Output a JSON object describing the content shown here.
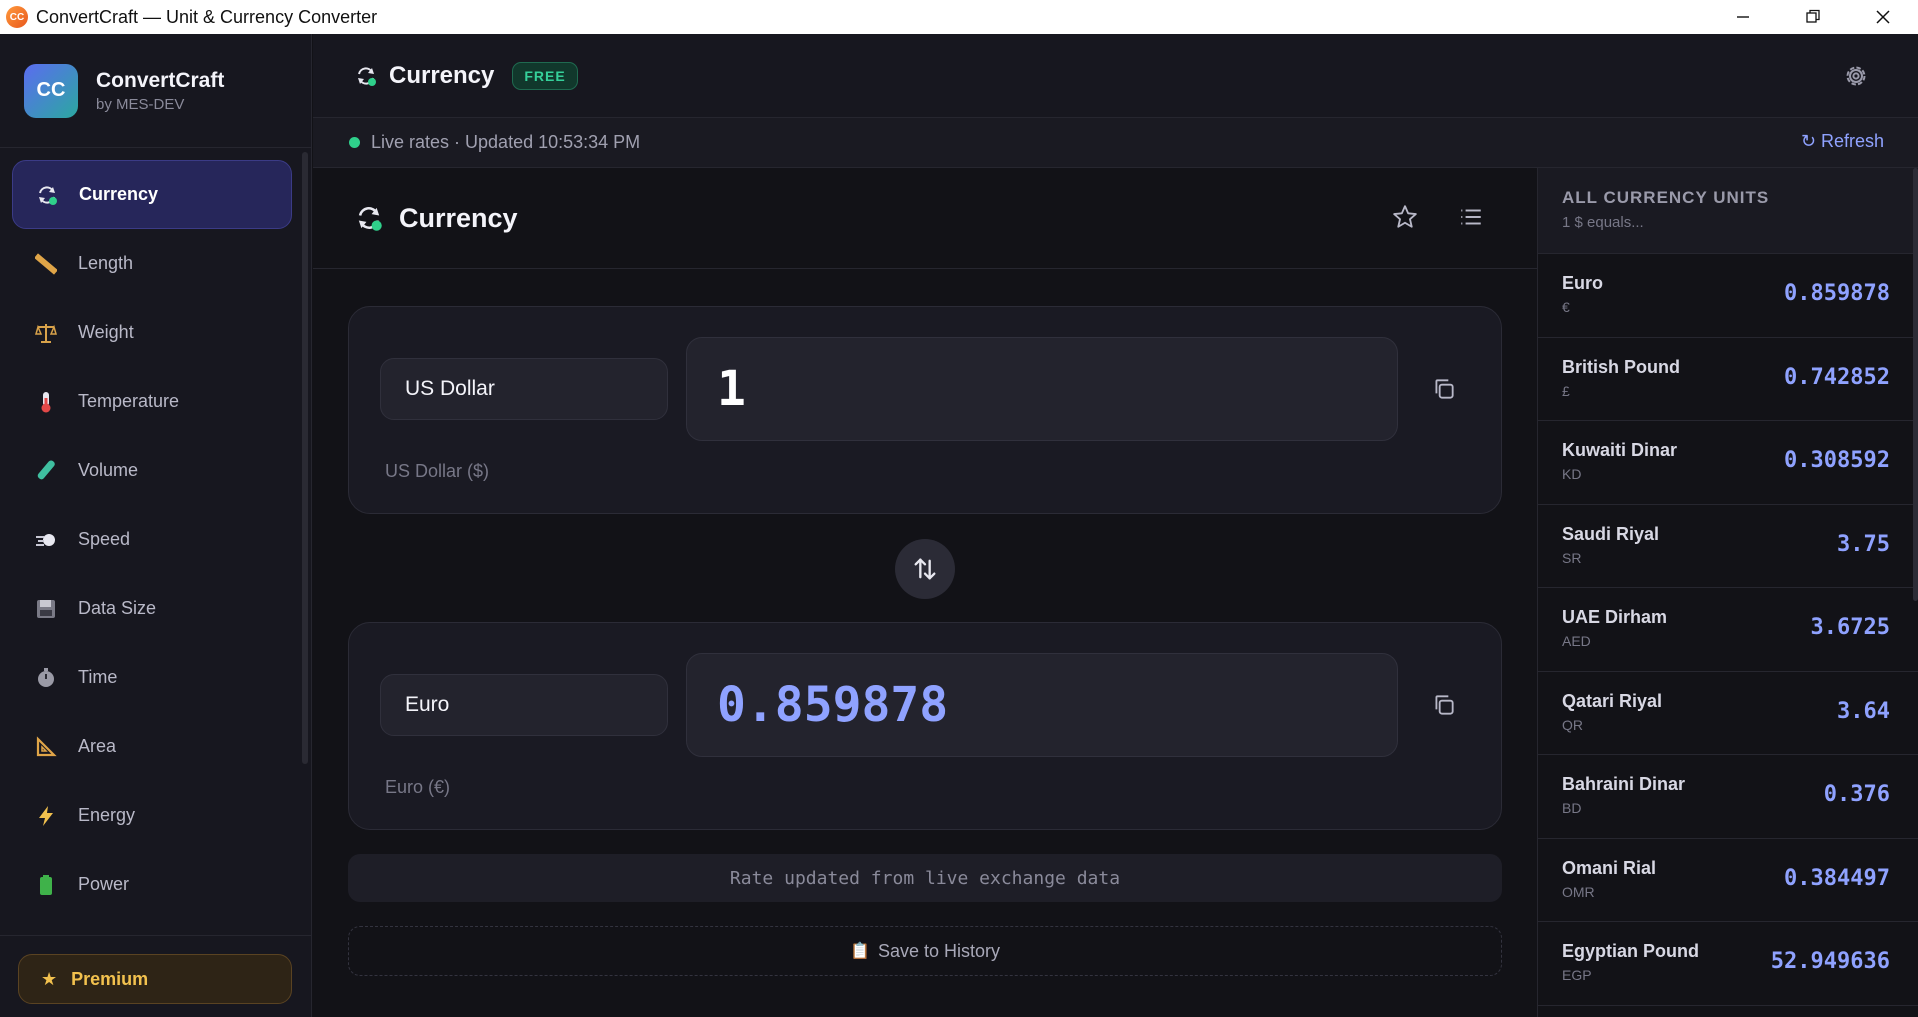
{
  "window": {
    "title": "ConvertCraft — Unit & Currency Converter",
    "icon_text": "CC"
  },
  "brand": {
    "logo": "CC",
    "name": "ConvertCraft",
    "byline": "by MES-DEV"
  },
  "sidebar": {
    "items": [
      {
        "label": "Currency",
        "icon": "currency-exchange-icon",
        "active": true
      },
      {
        "label": "Length",
        "icon": "ruler-icon"
      },
      {
        "label": "Weight",
        "icon": "scale-icon"
      },
      {
        "label": "Temperature",
        "icon": "thermometer-icon"
      },
      {
        "label": "Volume",
        "icon": "test-tube-icon"
      },
      {
        "label": "Speed",
        "icon": "dash-icon"
      },
      {
        "label": "Data Size",
        "icon": "floppy-disk-icon"
      },
      {
        "label": "Time",
        "icon": "stopwatch-icon"
      },
      {
        "label": "Area",
        "icon": "triangle-ruler-icon"
      },
      {
        "label": "Energy",
        "icon": "lightning-icon"
      },
      {
        "label": "Power",
        "icon": "battery-icon"
      }
    ],
    "premium_label": "Premium"
  },
  "header": {
    "title": "Currency",
    "badge": "FREE"
  },
  "status": {
    "text": "Live rates · Updated 10:53:34 PM",
    "refresh_label": "↻ Refresh",
    "dot_color": "#2fd08b"
  },
  "converter": {
    "title": "Currency",
    "from": {
      "unit": "US Dollar",
      "value": "1",
      "sub": "US Dollar ($)"
    },
    "to": {
      "unit": "Euro",
      "value": "0.859878",
      "sub": "Euro (€)"
    },
    "rate_note": "Rate updated from live exchange data",
    "save_label": "Save to History"
  },
  "units_panel": {
    "title": "ALL CURRENCY UNITS",
    "subtitle": "1 $ equals...",
    "rows": [
      {
        "name": "Euro",
        "symbol": "€",
        "value": "0.859878"
      },
      {
        "name": "British Pound",
        "symbol": "£",
        "value": "0.742852"
      },
      {
        "name": "Kuwaiti Dinar",
        "symbol": "KD",
        "value": "0.308592"
      },
      {
        "name": "Saudi Riyal",
        "symbol": "SR",
        "value": "3.75"
      },
      {
        "name": "UAE Dirham",
        "symbol": "AED",
        "value": "3.6725"
      },
      {
        "name": "Qatari Riyal",
        "symbol": "QR",
        "value": "3.64"
      },
      {
        "name": "Bahraini Dinar",
        "symbol": "BD",
        "value": "0.376"
      },
      {
        "name": "Omani Rial",
        "symbol": "OMR",
        "value": "0.384497"
      },
      {
        "name": "Egyptian Pound",
        "symbol": "EGP",
        "value": "52.949636"
      }
    ]
  },
  "colors": {
    "accent": "#8fa2ff",
    "premium": "#f2c14e",
    "free_badge": "#35d09a"
  }
}
